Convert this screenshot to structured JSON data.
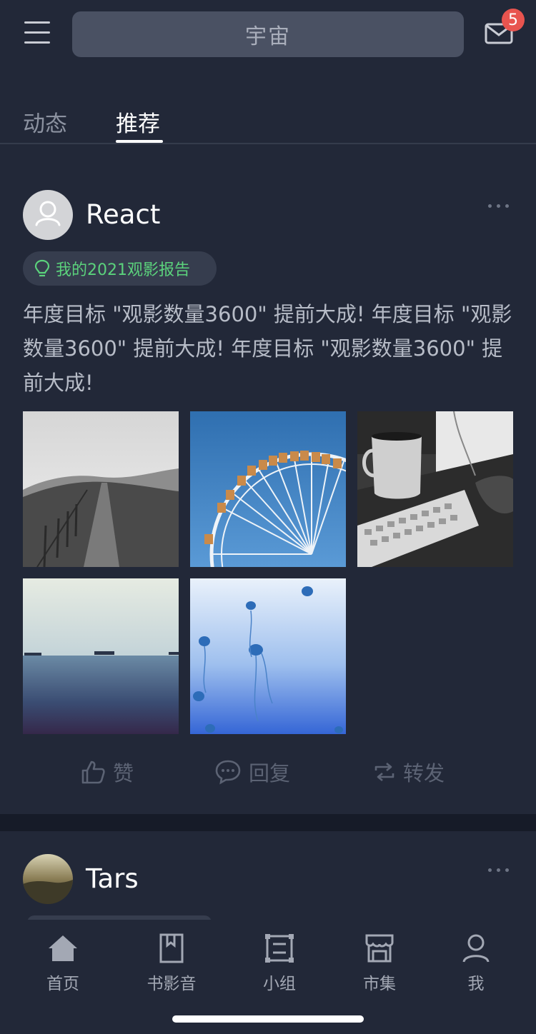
{
  "header": {
    "search_text": "宇宙",
    "notification_count": "5"
  },
  "tabs": [
    {
      "label": "动态",
      "active": false
    },
    {
      "label": "推荐",
      "active": true
    }
  ],
  "posts": [
    {
      "author": "React",
      "tag": "我的2021观影报告",
      "text": "年度目标 \"观影数量3600\" 提前大成! 年度目标 \"观影数量3600\" 提前大成! 年度目标 \"观影数量3600\" 提前大成!",
      "photos": [
        "hills-with-fence",
        "ferris-wheel",
        "mug-and-keyboard",
        "sea-with-ships",
        "jellyfish"
      ],
      "actions": {
        "like": "赞",
        "reply": "回复",
        "share": "转发"
      }
    },
    {
      "author": "Tars"
    }
  ],
  "tabbar": [
    {
      "label": "首页",
      "icon": "home-icon",
      "active": true
    },
    {
      "label": "书影音",
      "icon": "book-icon",
      "active": false
    },
    {
      "label": "小组",
      "icon": "group-icon",
      "active": false
    },
    {
      "label": "市集",
      "icon": "shop-icon",
      "active": false
    },
    {
      "label": "我",
      "icon": "user-icon",
      "active": false
    }
  ],
  "colors": {
    "background": "#222838",
    "accent_green": "#5bd27c",
    "badge_red": "#e8544f"
  }
}
